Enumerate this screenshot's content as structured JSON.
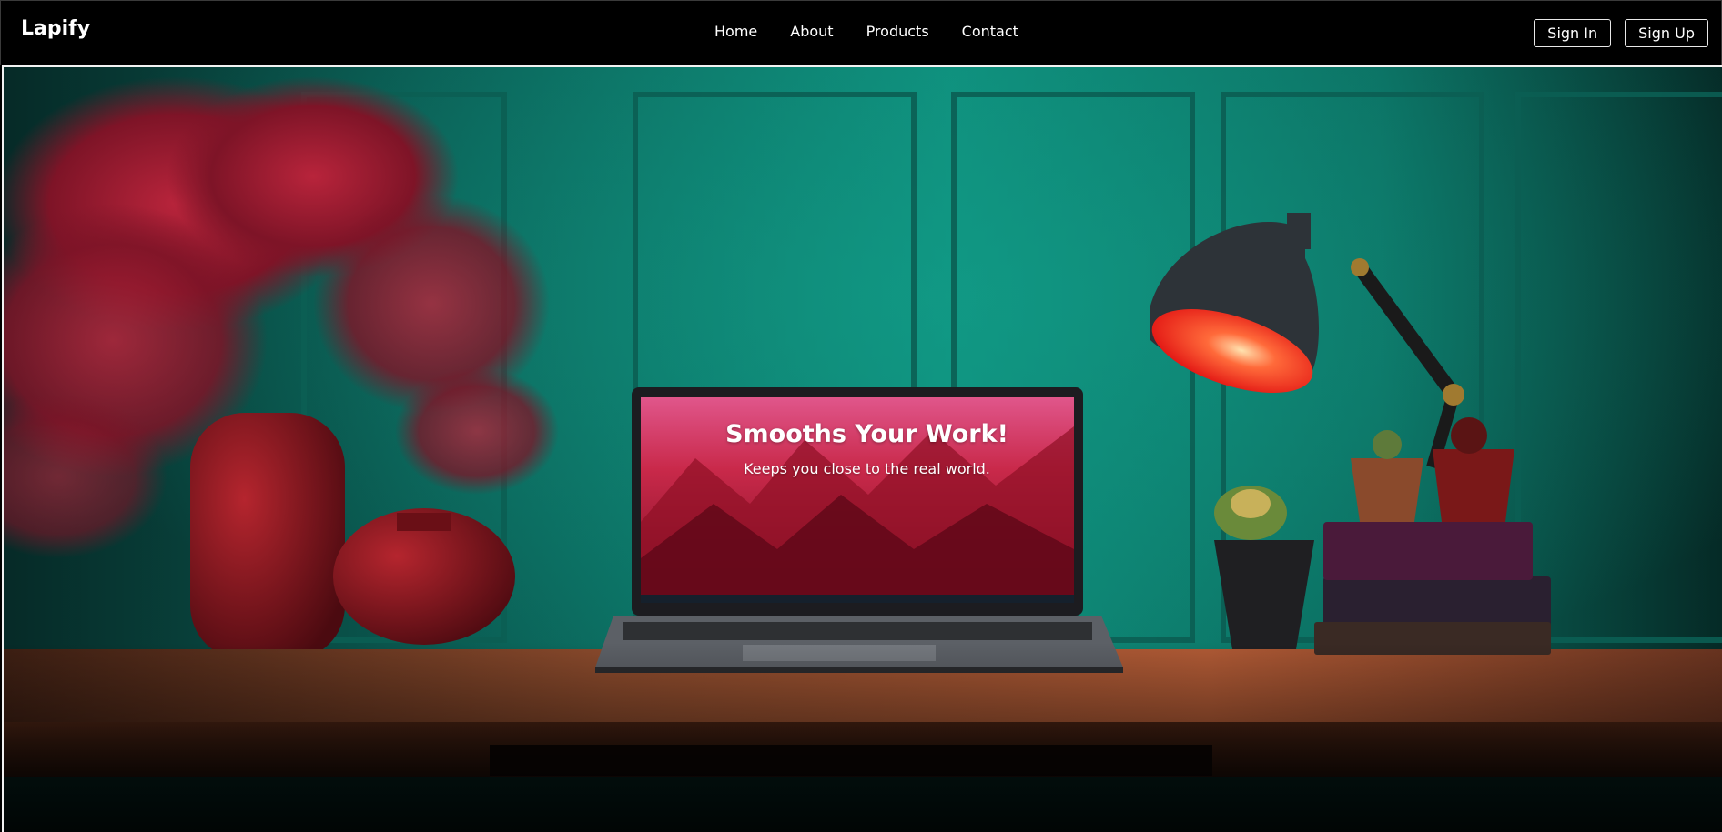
{
  "navbar": {
    "brand": "Lapify",
    "links": [
      {
        "label": "Home"
      },
      {
        "label": "About"
      },
      {
        "label": "Products"
      },
      {
        "label": "Contact"
      }
    ],
    "sign_in": "Sign In",
    "sign_up": "Sign Up"
  },
  "hero": {
    "title": "Smooths Your Work!",
    "subtitle": "Keeps you close to the real world.",
    "image_subject": "desk-scene-laptop-lamp-plants"
  },
  "colors": {
    "nav_bg": "#000000",
    "text": "#ffffff",
    "wall": "#0e7d6d",
    "desk": "#8a4a2c",
    "accent_red": "#b8142a"
  }
}
